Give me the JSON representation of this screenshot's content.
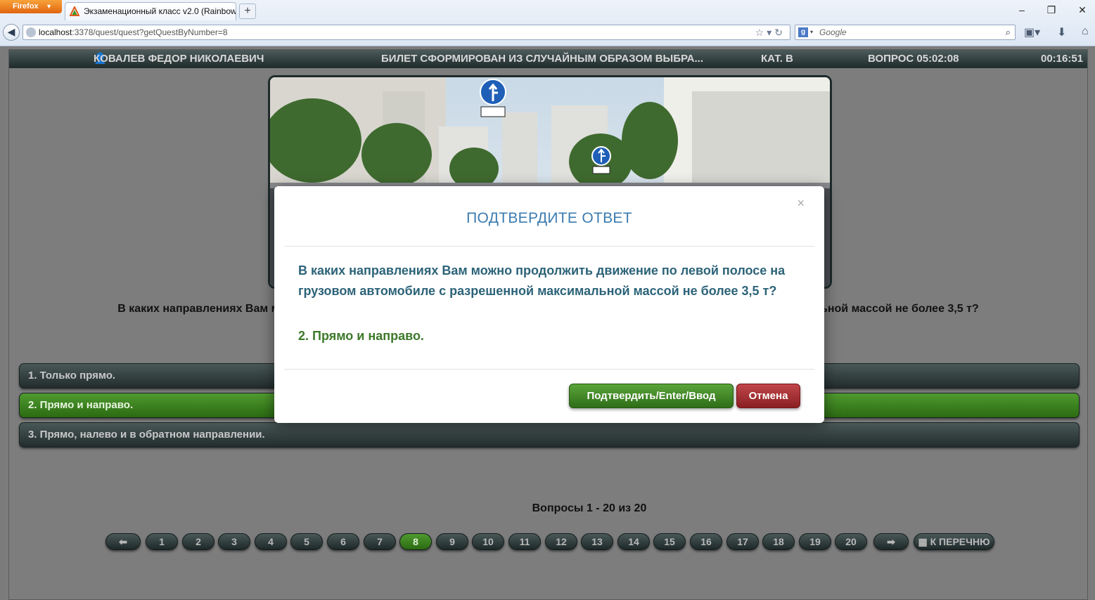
{
  "browser": {
    "menu_label": "Firefox",
    "tab_title": "Экзаменационный класс v2.0 (Rainbow...",
    "new_tab_label": "+",
    "url_host": "localhost",
    "url_rest": ":3378/quest/quest?getQuestByNumber=8",
    "search_placeholder": "Google"
  },
  "topbar": {
    "student": "КОВАЛЕВ ФЕДОР НИКОЛАЕВИЧ",
    "ticket_info": "БИЛЕТ СФОРМИРОВАН ИЗ СЛУЧАЙНЫМ ОБРАЗОМ ВЫБРА...",
    "category": "КАТ. В",
    "question_timer": "ВОПРОС 05:02:08",
    "total_timer": "00:16:51"
  },
  "question": {
    "text": "В каких направлениях Вам можно продолжить движение по левой полосе на грузовом автомобиле с разрешенной максимальной массой не более 3,5 т?"
  },
  "answers": [
    "1. Только прямо.",
    "2. Прямо и направо.",
    "3. Прямо, налево и в обратном направлении."
  ],
  "selected_answer": 2,
  "pager": {
    "info": "Вопросы 1 - 20 из 20",
    "pages": [
      "1",
      "2",
      "3",
      "4",
      "5",
      "6",
      "7",
      "8",
      "9",
      "10",
      "11",
      "12",
      "13",
      "14",
      "15",
      "16",
      "17",
      "18",
      "19",
      "20"
    ],
    "current": "8",
    "prev_label": "🡐",
    "next_label": "🡒",
    "list_label": "К ПЕРЕЧНЮ"
  },
  "modal": {
    "title": "ПОДТВЕРДИТЕ ОТВЕТ",
    "close_label": "×",
    "question": "В каких направлениях Вам можно продолжить движение по левой полосе на грузовом автомобиле с разрешенной максимальной массой не более 3,5 т?",
    "answer": "2. Прямо и направо.",
    "confirm_label": "Подтвердить/Enter/Ввод",
    "cancel_label": "Отмена"
  },
  "colors": {
    "accent_green": "#3d7a2a",
    "cancel_red": "#a3292c",
    "title_blue": "#3b7bb0"
  }
}
